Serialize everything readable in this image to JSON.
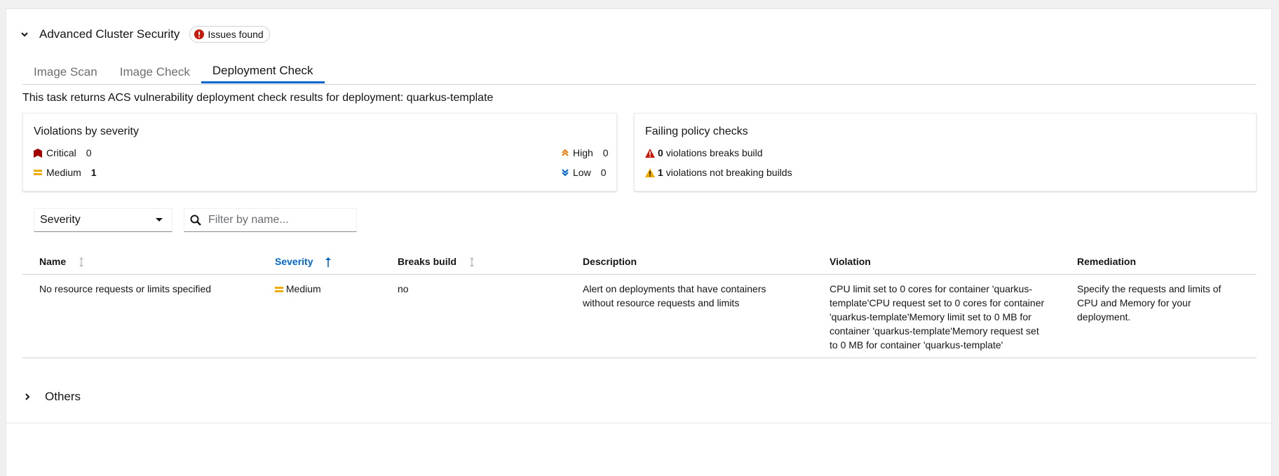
{
  "section": {
    "title": "Advanced Cluster Security",
    "badge": "Issues found",
    "badge_color": "#c9190b"
  },
  "tabs": [
    {
      "label": "Image Scan",
      "active": false
    },
    {
      "label": "Image Check",
      "active": false
    },
    {
      "label": "Deployment Check",
      "active": true
    }
  ],
  "description": "This task returns ACS vulnerability deployment check results for deployment: quarkus-template",
  "violations_card": {
    "title": "Violations by severity",
    "critical": {
      "label": "Critical",
      "count": "0",
      "color": "#a30000"
    },
    "medium": {
      "label": "Medium",
      "count": "1",
      "color": "#f0ab00"
    },
    "high": {
      "label": "High",
      "count": "0",
      "color": "#ec7a08"
    },
    "low": {
      "label": "Low",
      "count": "0",
      "color": "#06c"
    }
  },
  "policy_card": {
    "title": "Failing policy checks",
    "breaks_count": "0",
    "breaks_text": "violations breaks build",
    "breaks_color": "#c9190b",
    "not_breaking_count": "1",
    "not_breaking_text": "violations not breaking builds",
    "not_breaking_color": "#f0ab00"
  },
  "toolbar": {
    "severity_select": "Severity",
    "search_placeholder": "Filter by name..."
  },
  "table": {
    "columns": [
      "Name",
      "Severity",
      "Breaks build",
      "Description",
      "Violation",
      "Remediation"
    ],
    "sorted_color": "#06c",
    "rows": [
      {
        "name": "No resource requests or limits specified",
        "severity": "Medium",
        "breaks_build": "no",
        "description": "Alert on deployments that have containers without resource requests and limits",
        "violation": "CPU limit set to 0 cores for container 'quarkus-template'CPU request set to 0 cores for container 'quarkus-template'Memory limit set to 0 MB for container 'quarkus-template'Memory request set to 0 MB for container 'quarkus-template'",
        "remediation": "Specify the requests and limits of CPU and Memory for your deployment."
      }
    ]
  },
  "others": {
    "title": "Others"
  }
}
